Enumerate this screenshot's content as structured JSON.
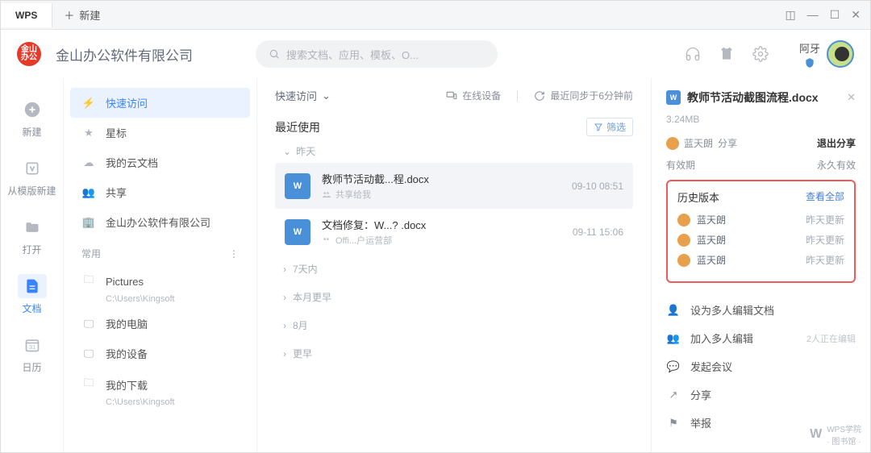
{
  "titlebar": {
    "app": "WPS",
    "newtab": "新建"
  },
  "header": {
    "company": "金山办公软件有限公司",
    "search_placeholder": "搜索文档、应用、模板、O...",
    "user_name": "阿牙"
  },
  "rail": {
    "new": "新建",
    "template": "从模版新建",
    "open": "打开",
    "docs": "文档",
    "calendar": "日历"
  },
  "sidebar": {
    "quick": "快速访问",
    "star": "星标",
    "cloud": "我的云文档",
    "share": "共享",
    "company": "金山办公软件有限公司",
    "section_common": "常用",
    "pictures": "Pictures",
    "pictures_path": "C:\\Users\\Kingsoft",
    "mypc": "我的电脑",
    "mydevice": "我的设备",
    "mydownload": "我的下载",
    "download_path": "C:\\Users\\Kingsoft"
  },
  "content": {
    "crumb": "快速访问",
    "online_devices": "在线设备",
    "last_sync": "最近同步于6分钟前",
    "recent": "最近使用",
    "filter": "筛选",
    "group_yesterday": "昨天",
    "file1_name": "教师节活动截...程.docx",
    "file1_sub": "共享给我",
    "file1_time": "09-10 08:51",
    "file2_name": "文档修复：W...? .docx",
    "file2_sub": "Offi...户运营部",
    "file2_time": "09-11 15:06",
    "col_7days": "7天内",
    "col_month_earlier": "本月更早",
    "col_aug": "8月",
    "col_earlier": "更早"
  },
  "detail": {
    "title": "教师节活动截图流程.docx",
    "size": "3.24MB",
    "owner": "蓝天朗",
    "owner_action": "分享",
    "exit_share": "退出分享",
    "validity_label": "有效期",
    "validity_value": "永久有效",
    "history_title": "历史版本",
    "history_all": "查看全部",
    "history_items": [
      {
        "name": "蓝天朗",
        "time": "昨天更新"
      },
      {
        "name": "蓝天朗",
        "time": "昨天更新"
      },
      {
        "name": "蓝天朗",
        "time": "昨天更新"
      }
    ],
    "action_multi_edit_doc": "设为多人编辑文档",
    "action_join_multi": "加入多人编辑",
    "action_join_hint": "2人正在编辑",
    "action_meeting": "发起会议",
    "action_share": "分享",
    "action_report": "举报",
    "college": "WPS学院",
    "college_sub": "· 图书馆 ·"
  }
}
